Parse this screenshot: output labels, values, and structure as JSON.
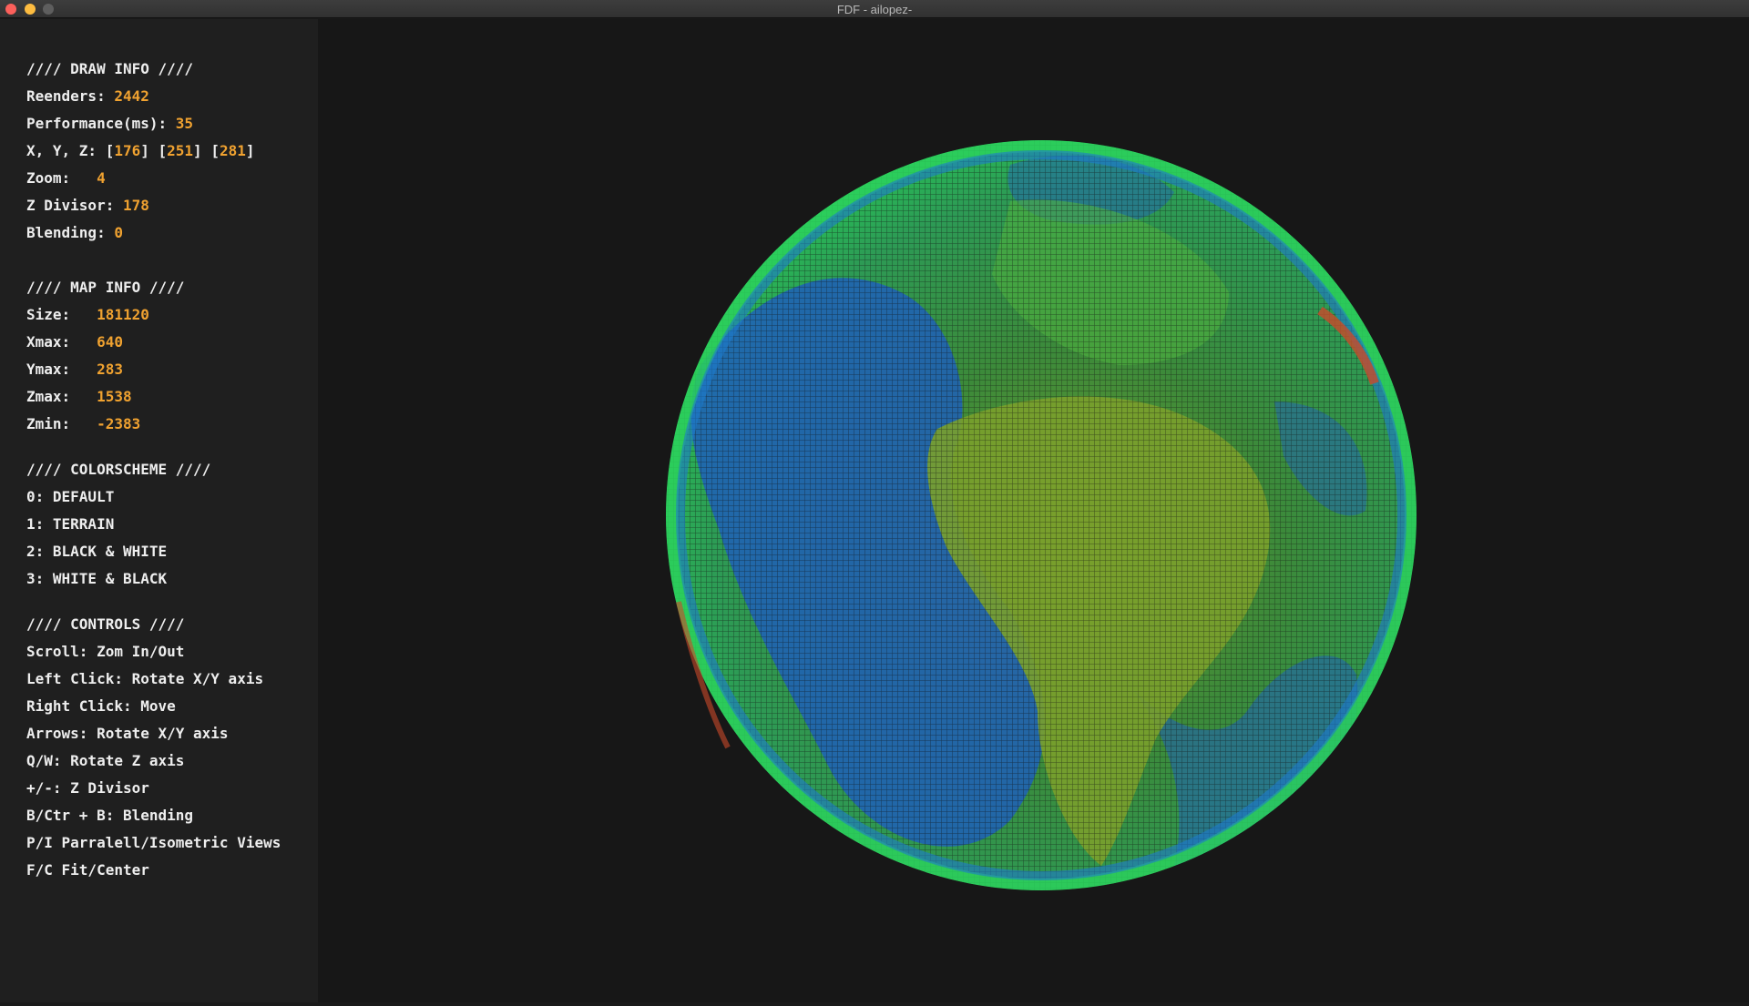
{
  "window": {
    "title": "FDF - ailopez-"
  },
  "colors": {
    "value": "#f0a230",
    "text": "#eeeeee",
    "sidebar_bg": "#1f1f1f",
    "viewport_bg": "#171717"
  },
  "draw_info": {
    "header": "//// DRAW INFO ////",
    "reenders_label": "Reenders: ",
    "reenders": "2442",
    "performance_label": "Performance(ms): ",
    "performance": "35",
    "xyz_label": "X, Y, Z: [",
    "x": "176",
    "sep1": "] [",
    "y": "251",
    "sep2": "] [",
    "z": "281",
    "close": "]",
    "zoom_label": "Zoom:   ",
    "zoom": "4",
    "zdivisor_label": "Z Divisor: ",
    "zdivisor": "178",
    "blending_label": "Blending: ",
    "blending": "0"
  },
  "map_info": {
    "header": "//// MAP INFO ////",
    "size_label": "Size:   ",
    "size": "181120",
    "xmax_label": "Xmax:   ",
    "xmax": "640",
    "ymax_label": "Ymax:   ",
    "ymax": "283",
    "zmax_label": "Zmax:   ",
    "zmax": "1538",
    "zmin_label": "Zmin:   ",
    "zmin": "-2383"
  },
  "colorscheme": {
    "header": "//// COLORSCHEME ////",
    "items": [
      "0: DEFAULT",
      "1: TERRAIN",
      "2: BLACK & WHITE",
      "3: WHITE & BLACK"
    ]
  },
  "controls": {
    "header": "//// CONTROLS ////",
    "items": [
      "Scroll: Zom In/Out",
      "Left Click: Rotate X/Y axis",
      "Right Click: Move",
      "Arrows: Rotate X/Y axis",
      "Q/W: Rotate Z axis",
      "+/-: Z Divisor",
      "B/Ctr + B: Blending",
      "P/I Parralell/Isometric Views",
      "F/C Fit/Center"
    ]
  },
  "render": {
    "subject": "wireframe-globe",
    "palette": [
      "#2ecf5a",
      "#1e7acc",
      "#1e4fb3",
      "#7a9a2a",
      "#c94a2a"
    ]
  }
}
